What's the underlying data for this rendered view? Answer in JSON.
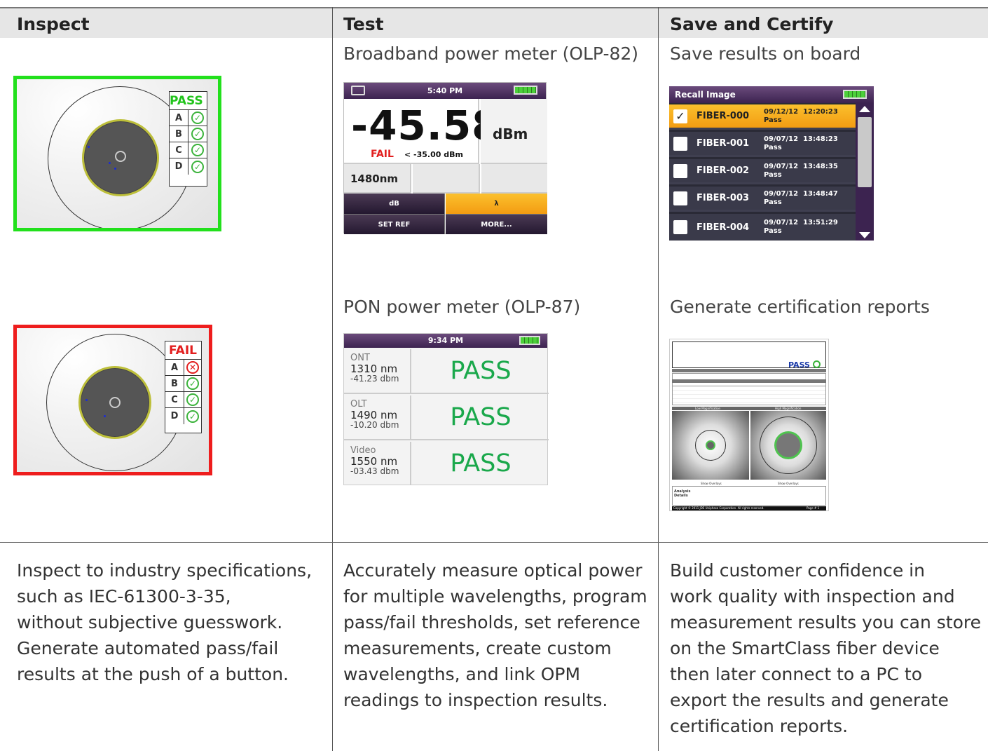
{
  "headers": {
    "inspect": "Inspect",
    "test": "Test",
    "save": "Save and Certify"
  },
  "captions": {
    "olp82": "Broadband power meter (OLP-82)",
    "save_onboard": "Save results on board",
    "olp87": "PON power meter (OLP-87)",
    "reports": "Generate certification reports"
  },
  "inspect": {
    "pass": {
      "label": "PASS",
      "rows": [
        {
          "zone": "A",
          "result": "pass"
        },
        {
          "zone": "B",
          "result": "pass"
        },
        {
          "zone": "C",
          "result": "pass"
        },
        {
          "zone": "D",
          "result": "pass"
        }
      ]
    },
    "fail": {
      "label": "FAIL",
      "rows": [
        {
          "zone": "A",
          "result": "fail"
        },
        {
          "zone": "B",
          "result": "pass"
        },
        {
          "zone": "C",
          "result": "pass"
        },
        {
          "zone": "D",
          "result": "pass"
        }
      ]
    }
  },
  "olp82": {
    "time": "5:40 PM",
    "reading": "-45.58",
    "unit": "dBm",
    "status": "FAIL",
    "threshold": "< -35.00 dBm",
    "wavelength": "1480nm",
    "buttons": [
      "dB",
      "λ",
      "SET REF",
      "MORE..."
    ]
  },
  "recall": {
    "title": "Recall Image",
    "items": [
      {
        "name": "FIBER-000",
        "date": "09/12/12",
        "time": "12:20:23",
        "status": "Pass",
        "checked": true
      },
      {
        "name": "FIBER-001",
        "date": "09/07/12",
        "time": "13:48:23",
        "status": "Pass",
        "checked": false
      },
      {
        "name": "FIBER-002",
        "date": "09/07/12",
        "time": "13:48:35",
        "status": "Pass",
        "checked": false
      },
      {
        "name": "FIBER-003",
        "date": "09/07/12",
        "time": "13:48:47",
        "status": "Pass",
        "checked": false
      },
      {
        "name": "FIBER-004",
        "date": "09/07/12",
        "time": "13:51:29",
        "status": "Pass",
        "checked": false
      }
    ]
  },
  "pon": {
    "time": "9:34 PM",
    "rows": [
      {
        "type": "ONT",
        "wl": "1310 nm",
        "dbm": "-41.23 dbm",
        "result": "PASS"
      },
      {
        "type": "OLT",
        "wl": "1490 nm",
        "dbm": "-10.20 dbm",
        "result": "PASS"
      },
      {
        "type": "Video",
        "wl": "1550 nm",
        "dbm": "-03.43 dbm",
        "result": "PASS"
      }
    ]
  },
  "report": {
    "pass": "PASS",
    "low_mag": "Low Magnification",
    "high_mag": "High Magnification",
    "overlay": "Show Overlays",
    "analysis": "Analysis Details",
    "copyright": "Copyright © 2011 JDS Uniphase Corporation. All rights reserved.",
    "page": "Page # 1"
  },
  "descriptions": {
    "inspect": [
      "Inspect to industry specifications,",
      "such as IEC-61300-3-35,",
      "without subjective guesswork.",
      "Generate automated pass/fail",
      "results at the push of a button."
    ],
    "test": [
      "Accurately measure optical power",
      "for multiple wavelengths, program",
      "pass/fail thresholds, set reference",
      "measurements, create custom",
      "wavelengths, and link OPM",
      "readings to inspection results."
    ],
    "save": [
      "Build customer confidence in",
      "work quality with inspection and",
      "measurement results you can store",
      "on the SmartClass fiber device",
      "then later connect to a PC to",
      "export the results and generate",
      "certification reports."
    ]
  },
  "colors": {
    "pass_green": "#22e01c",
    "fail_red": "#ee1d1d",
    "device_purple": "#3c2350",
    "highlight_orange": "#f5a623",
    "pon_green": "#1aa84b"
  }
}
